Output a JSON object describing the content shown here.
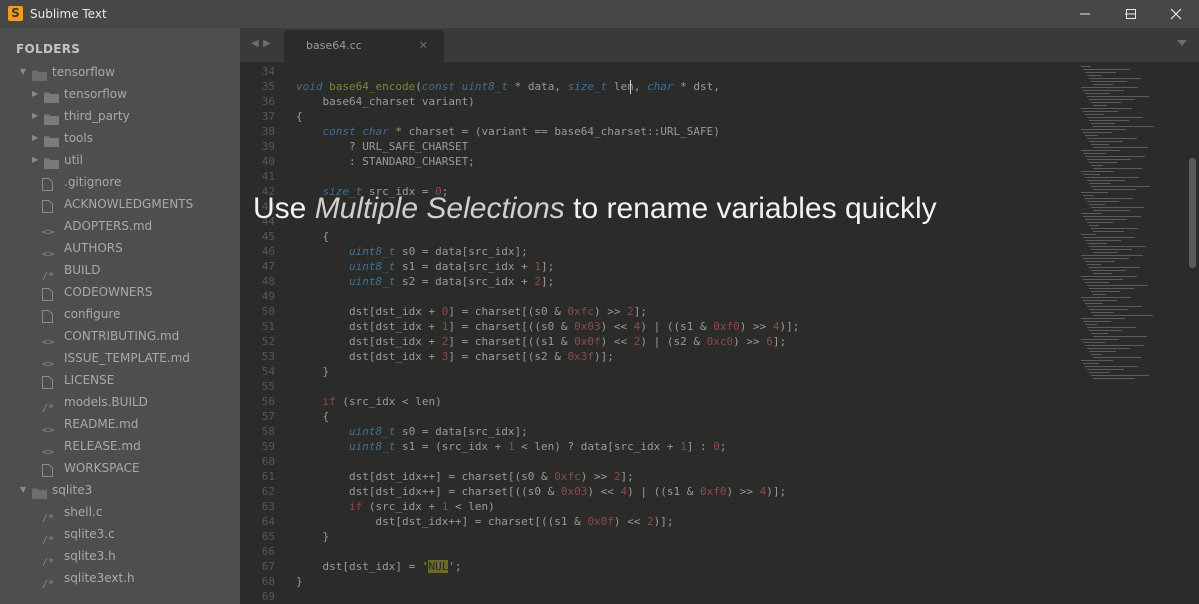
{
  "window": {
    "title": "Sublime Text",
    "app_icon": "sublime-text-icon",
    "controls": [
      "minimize-icon",
      "maximize-icon",
      "close-icon"
    ]
  },
  "sidebar": {
    "heading": "FOLDERS",
    "items": [
      {
        "label": "tensorflow",
        "type": "folder",
        "depth": 0,
        "expanded": true
      },
      {
        "label": "tensorflow",
        "type": "folder",
        "depth": 1,
        "expanded": false
      },
      {
        "label": "third_party",
        "type": "folder",
        "depth": 1,
        "expanded": false
      },
      {
        "label": "tools",
        "type": "folder",
        "depth": 1,
        "expanded": false
      },
      {
        "label": "util",
        "type": "folder",
        "depth": 1,
        "expanded": false
      },
      {
        "label": ".gitignore",
        "type": "file",
        "depth": 1,
        "icon": "file-icon"
      },
      {
        "label": "ACKNOWLEDGMENTS",
        "type": "file",
        "depth": 1,
        "icon": "file-icon"
      },
      {
        "label": "ADOPTERS.md",
        "type": "file",
        "depth": 1,
        "icon": "code-file-icon"
      },
      {
        "label": "AUTHORS",
        "type": "file",
        "depth": 1,
        "icon": "code-file-icon"
      },
      {
        "label": "BUILD",
        "type": "file",
        "depth": 1,
        "icon": "comment-file-icon"
      },
      {
        "label": "CODEOWNERS",
        "type": "file",
        "depth": 1,
        "icon": "file-icon"
      },
      {
        "label": "configure",
        "type": "file",
        "depth": 1,
        "icon": "file-icon"
      },
      {
        "label": "CONTRIBUTING.md",
        "type": "file",
        "depth": 1,
        "icon": "code-file-icon"
      },
      {
        "label": "ISSUE_TEMPLATE.md",
        "type": "file",
        "depth": 1,
        "icon": "code-file-icon"
      },
      {
        "label": "LICENSE",
        "type": "file",
        "depth": 1,
        "icon": "file-icon"
      },
      {
        "label": "models.BUILD",
        "type": "file",
        "depth": 1,
        "icon": "comment-file-icon"
      },
      {
        "label": "README.md",
        "type": "file",
        "depth": 1,
        "icon": "code-file-icon"
      },
      {
        "label": "RELEASE.md",
        "type": "file",
        "depth": 1,
        "icon": "code-file-icon"
      },
      {
        "label": "WORKSPACE",
        "type": "file",
        "depth": 1,
        "icon": "file-icon"
      },
      {
        "label": "sqlite3",
        "type": "folder",
        "depth": 0,
        "expanded": true
      },
      {
        "label": "shell.c",
        "type": "file",
        "depth": 1,
        "icon": "comment-file-icon"
      },
      {
        "label": "sqlite3.c",
        "type": "file",
        "depth": 1,
        "icon": "comment-file-icon"
      },
      {
        "label": "sqlite3.h",
        "type": "file",
        "depth": 1,
        "icon": "comment-file-icon"
      },
      {
        "label": "sqlite3ext.h",
        "type": "file",
        "depth": 1,
        "icon": "comment-file-icon"
      }
    ]
  },
  "tabs": [
    {
      "label": "base64.cc",
      "active": true
    }
  ],
  "editor": {
    "lines": [
      {
        "no": "34",
        "text": ""
      },
      {
        "no": "35",
        "text": "void base64_encode(const uint8_t * data, size_t len, char * dst,"
      },
      {
        "no": "36",
        "text": "    base64_charset variant)"
      },
      {
        "no": "37",
        "text": "{"
      },
      {
        "no": "38",
        "text": "    const char * charset = (variant == base64_charset::URL_SAFE)"
      },
      {
        "no": "39",
        "text": "        ? URL_SAFE_CHARSET"
      },
      {
        "no": "40",
        "text": "        : STANDARD_CHARSET;"
      },
      {
        "no": "41",
        "text": ""
      },
      {
        "no": "42",
        "text": "    size_t src_idx = 0;"
      },
      {
        "no": "43",
        "text": ""
      },
      {
        "no": "44",
        "text": ""
      },
      {
        "no": "45",
        "text": "    {"
      },
      {
        "no": "46",
        "text": "        uint8_t s0 = data[src_idx];"
      },
      {
        "no": "47",
        "text": "        uint8_t s1 = data[src_idx + 1];"
      },
      {
        "no": "48",
        "text": "        uint8_t s2 = data[src_idx + 2];"
      },
      {
        "no": "49",
        "text": ""
      },
      {
        "no": "50",
        "text": "        dst[dst_idx + 0] = charset[(s0 & 0xfc) >> 2];"
      },
      {
        "no": "51",
        "text": "        dst[dst_idx + 1] = charset[((s0 & 0x03) << 4) | ((s1 & 0xf0) >> 4)];"
      },
      {
        "no": "52",
        "text": "        dst[dst_idx + 2] = charset[((s1 & 0x0f) << 2) | (s2 & 0xc0) >> 6];"
      },
      {
        "no": "53",
        "text": "        dst[dst_idx + 3] = charset[(s2 & 0x3f)];"
      },
      {
        "no": "54",
        "text": "    }"
      },
      {
        "no": "55",
        "text": ""
      },
      {
        "no": "56",
        "text": "    if (src_idx < len)"
      },
      {
        "no": "57",
        "text": "    {"
      },
      {
        "no": "58",
        "text": "        uint8_t s0 = data[src_idx];"
      },
      {
        "no": "59",
        "text": "        uint8_t s1 = (src_idx + 1 < len) ? data[src_idx + 1] : 0;"
      },
      {
        "no": "60",
        "text": ""
      },
      {
        "no": "61",
        "text": "        dst[dst_idx++] = charset[(s0 & 0xfc) >> 2];"
      },
      {
        "no": "62",
        "text": "        dst[dst_idx++] = charset[((s0 & 0x03) << 4) | ((s1 & 0xf0) >> 4)];"
      },
      {
        "no": "63",
        "text": "        if (src_idx + 1 < len)"
      },
      {
        "no": "64",
        "text": "            dst[dst_idx++] = charset[((s1 & 0x0f) << 2)];"
      },
      {
        "no": "65",
        "text": "    }"
      },
      {
        "no": "66",
        "text": ""
      },
      {
        "no": "67",
        "text": "    dst[dst_idx] = 'NUL';"
      },
      {
        "no": "68",
        "text": "}"
      },
      {
        "no": "69",
        "text": ""
      }
    ]
  },
  "caption": {
    "prefix": "Use ",
    "emphasis": "Multiple Selections",
    "suffix": " to rename variables quickly"
  },
  "colors": {
    "titlebar": "#474747",
    "sidebar": "#4e4e4e",
    "editor_bg": "#2b2b2a",
    "keyword": "#8a4a52",
    "type": "#3f6f93",
    "number": "#8a4a52",
    "accent": "#f19c1f"
  }
}
